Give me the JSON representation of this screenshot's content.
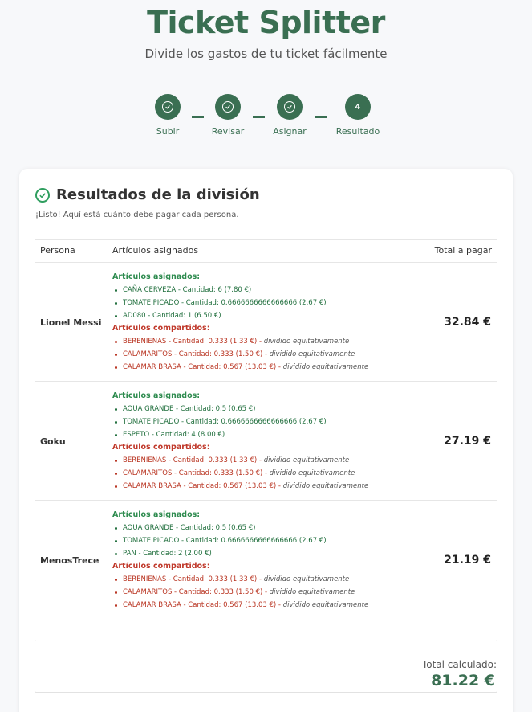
{
  "app": {
    "title": "Ticket Splitter",
    "subtitle": "Divide los gastos de tu ticket fácilmente"
  },
  "steps": [
    {
      "label": "Subir",
      "state": "completed",
      "icon": "check-icon"
    },
    {
      "label": "Revisar",
      "state": "completed",
      "icon": "check-icon"
    },
    {
      "label": "Asignar",
      "state": "completed",
      "icon": "check-icon"
    },
    {
      "label": "Resultado",
      "state": "current",
      "number": "4"
    }
  ],
  "results": {
    "title": "Resultados de la división",
    "description": "¡Listo! Aquí está cuánto debe pagar cada persona.",
    "columns": {
      "person": "Persona",
      "items": "Artículos asignados",
      "total": "Total a pagar"
    },
    "assigned_title": "Artículos asignados:",
    "shared_title": "Artículos compartidos:",
    "shared_suffix": "dividido equitativamente",
    "rows": [
      {
        "person": "Lionel Messi",
        "total": "32.84 €",
        "assigned": [
          "CAÑA CERVEZA - Cantidad: 6 (7.80 €)",
          "TOMATE PICADO - Cantidad: 0.6666666666666666 (2.67 €)",
          "AD080 - Cantidad: 1 (6.50 €)"
        ],
        "shared": [
          "BERENIENAS - Cantidad: 0.333 (1.33 €) -",
          "CALAMARITOS - Cantidad: 0.333 (1.50 €) -",
          "CALAMAR BRASA - Cantidad: 0.567 (13.03 €) -"
        ]
      },
      {
        "person": "Goku",
        "total": "27.19 €",
        "assigned": [
          "AQUA GRANDE - Cantidad: 0.5 (0.65 €)",
          "TOMATE PICADO - Cantidad: 0.6666666666666666 (2.67 €)",
          "ESPETO - Cantidad: 4 (8.00 €)"
        ],
        "shared": [
          "BERENIENAS - Cantidad: 0.333 (1.33 €) -",
          "CALAMARITOS - Cantidad: 0.333 (1.50 €) -",
          "CALAMAR BRASA - Cantidad: 0.567 (13.03 €) -"
        ]
      },
      {
        "person": "MenosTrece",
        "total": "21.19 €",
        "assigned": [
          "AQUA GRANDE - Cantidad: 0.5 (0.65 €)",
          "TOMATE PICADO - Cantidad: 0.6666666666666666 (2.67 €)",
          "PAN - Cantidad: 2 (2.00 €)"
        ],
        "shared": [
          "BERENIENAS - Cantidad: 0.333 (1.33 €) -",
          "CALAMARITOS - Cantidad: 0.333 (1.50 €) -",
          "CALAMAR BRASA - Cantidad: 0.567 (13.03 €) -"
        ]
      }
    ],
    "summary": {
      "label": "Total calculado:",
      "value": "81.22 €"
    }
  },
  "colors": {
    "brand": "#3a6f52",
    "assigned": "#1f6e3c",
    "shared": "#b8321f",
    "success": "#2f9e5f"
  }
}
